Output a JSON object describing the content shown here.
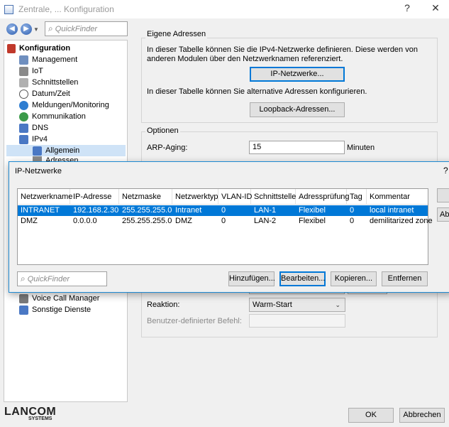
{
  "window": {
    "title": "Zentrale, ... Konfiguration",
    "help": "?",
    "close": "✕"
  },
  "nav": {
    "back": "◀",
    "forward": "▶",
    "quickfinder_placeholder": "QuickFinder"
  },
  "tree": {
    "items": [
      {
        "label": "Konfiguration",
        "bold": true
      },
      {
        "label": "Management"
      },
      {
        "label": "IoT"
      },
      {
        "label": "Schnittstellen"
      },
      {
        "label": "Datum/Zeit"
      },
      {
        "label": "Meldungen/Monitoring"
      },
      {
        "label": "Kommunikation"
      },
      {
        "label": "DNS"
      },
      {
        "label": "IPv4"
      },
      {
        "label": "Allgemein"
      },
      {
        "label": "Adressen"
      },
      {
        "label": "Voice Call Manager"
      },
      {
        "label": "Sonstige Dienste"
      }
    ]
  },
  "eigene_adressen": {
    "group_label": "Eigene Adressen",
    "desc1": "In dieser Tabelle können Sie die IPv4-Netzwerke definieren. Diese werden von anderen Modulen über den Netzwerknamen referenziert.",
    "btn_ip_netzwerke": "IP-Netzwerke...",
    "desc2": "In dieser Tabelle können Sie alternative Adressen konfigurieren.",
    "btn_loopback": "Loopback-Adressen..."
  },
  "optionen": {
    "group_label": "Optionen",
    "arp_label": "ARP-Aging:",
    "arp_value": "15",
    "arp_unit": "Minuten",
    "reaktion_label": "Reaktion:",
    "reaktion_value": "Warm-Start",
    "befehl_label": "Benutzer-definierter Befehl:",
    "befehl_value": ""
  },
  "footer": {
    "ok": "OK",
    "abbrechen": "Abbrechen",
    "logo": "LANCOM",
    "logo_sub": "SYSTEMS"
  },
  "dialog": {
    "title": "IP-Netzwerke",
    "help": "?",
    "columns": [
      "Netzwerkname",
      "IP-Adresse",
      "Netzmaske",
      "Netzwerktyp",
      "VLAN-ID",
      "Schnittstelle",
      "Adressprüfung",
      "Tag",
      "Kommentar"
    ],
    "rows": [
      [
        "INTRANET",
        "192.168.2.30",
        "255.255.255.0",
        "Intranet",
        "0",
        "LAN-1",
        "Flexibel",
        "0",
        "local intranet"
      ],
      [
        "DMZ",
        "0.0.0.0",
        "255.255.255.0",
        "DMZ",
        "0",
        "LAN-2",
        "Flexibel",
        "0",
        "demilitarized zone"
      ]
    ],
    "quickfinder_placeholder": "QuickFinder",
    "btn_add": "Hinzufügen...",
    "btn_edit": "Bearbeiten...",
    "btn_copy": "Kopieren...",
    "btn_remove": "Entfernen",
    "side_stub_2": "Ab"
  }
}
